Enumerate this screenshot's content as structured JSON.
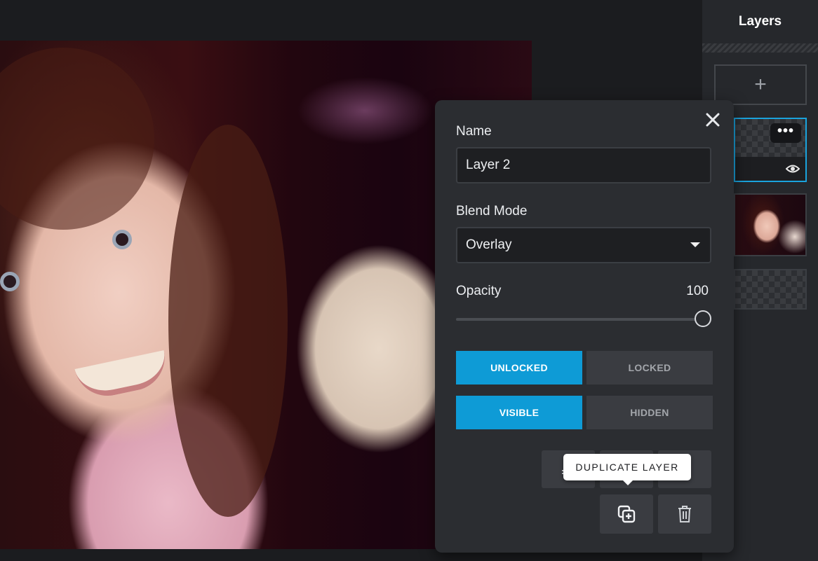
{
  "layers_panel": {
    "title": "Layers",
    "add_symbol": "+",
    "more_symbol": "•••"
  },
  "layer_props": {
    "name_label": "Name",
    "name_value": "Layer 2",
    "blend_label": "Blend Mode",
    "blend_value": "Overlay",
    "opacity_label": "Opacity",
    "opacity_value": "100",
    "lock_on": "UNLOCKED",
    "lock_off": "LOCKED",
    "visible_on": "VISIBLE",
    "visible_off": "HIDDEN",
    "tooltip": "DUPLICATE LAYER"
  },
  "colors": {
    "accent": "#0e9bd6",
    "panel_bg": "#2b2d31",
    "app_bg": "#1b1c1f"
  }
}
